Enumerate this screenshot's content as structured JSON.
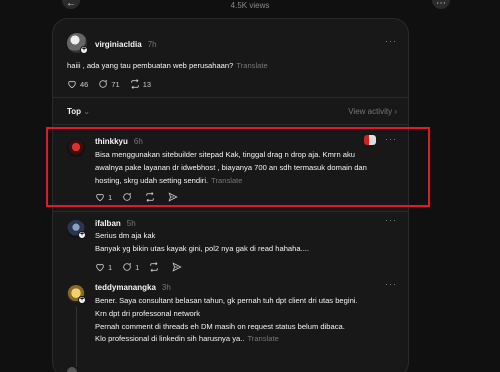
{
  "header": {
    "views": "4.5K views"
  },
  "main_post": {
    "username": "virginiacldia",
    "time": "7h",
    "text": "haiii , ada yang tau pembuatan web perusahaan?",
    "translate": "Translate",
    "likes": "46",
    "replies": "71",
    "shares": "13"
  },
  "sort": {
    "label": "Top",
    "view_activity": "View activity"
  },
  "replies": [
    {
      "username": "thinkkyu",
      "time": "6h",
      "lines": [
        "Bisa menggunakan sitebuilder sitepad Kak, tinggal drag n drop aja. Kmrn aku",
        "awalnya pake layanan dr idwebhost , biayanya 700 an sdh termasuk domain dan",
        "hosting, skrg udah setting sendiri."
      ],
      "translate": "Translate",
      "likes": "1"
    },
    {
      "username": "ifalban",
      "time": "5h",
      "lines": [
        "Serius dm aja kak",
        "Banyak yg bikin utas kayak gini, pol2 nya gak di read hahaha...."
      ],
      "likes": "1",
      "replies": "1"
    },
    {
      "username": "teddymanangka",
      "time": "3h",
      "lines": [
        "Bener. Saya consultant belasan tahun, gk pernah tuh dpt client dri utas begini.",
        "Krn dpt dri professonal network",
        "Pernah comment di threads eh DM masih on request status belum dibaca.",
        "Klo professional di linkedin sih harusnya ya.."
      ],
      "translate": "Translate"
    }
  ],
  "colors": {
    "highlight": "#e0192c",
    "bg": "#101010",
    "panel": "#181818"
  }
}
